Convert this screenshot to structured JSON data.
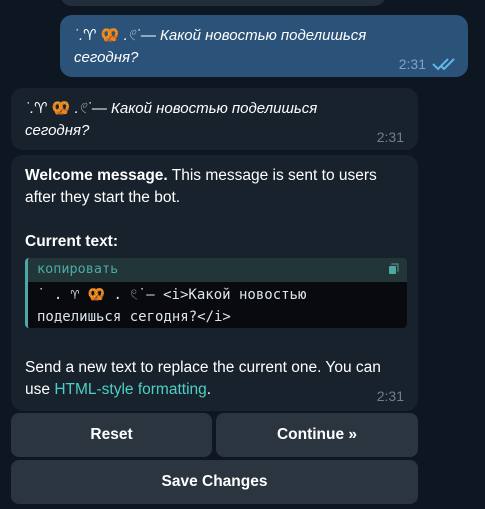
{
  "outgoing_message": {
    "text_prefix": "˙.♈",
    "emoji": "🥨",
    "text_suffix": ".𓏲˙—",
    "text": "Какой новостью поделишься сегодня?",
    "time": "2:31"
  },
  "bot_echo_message": {
    "text_prefix": "˙.♈",
    "emoji": "🥨",
    "text_suffix": ".𓏲˙—",
    "text": "Какой новостью поделишься сегодня?",
    "time": "2:31"
  },
  "bot_message": {
    "heading": "Welcome message.",
    "description": "This message is sent to users after they start the bot.",
    "current_text_label": "Current text:",
    "code_language": "копировать",
    "code_line1_prefix": "˙ . ♈",
    "code_line1_emoji": "🥨",
    "code_line1_rest": ". 𓏲˙— <i>Какой новостью",
    "code_line2": "поделишься сегодня?</i>",
    "instruction_before_link": "Send a new text to replace the current one. You can use ",
    "link_text": "HTML-style formatting",
    "instruction_after_link": ".",
    "time": "2:31"
  },
  "keyboard": {
    "reset_label": "Reset",
    "continue_label": "Continue »",
    "save_label": "Save Changes"
  },
  "colors": {
    "background": "#0e1621",
    "outgoing_bubble": "#2b5278",
    "incoming_bubble": "#18222d",
    "accent": "#4fcfc6",
    "button": "#2b3540"
  }
}
